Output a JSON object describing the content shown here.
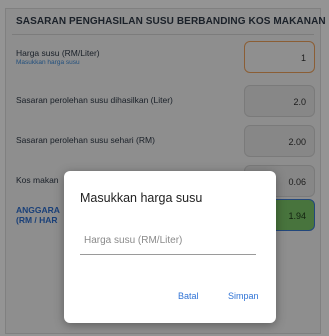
{
  "header": {
    "title": "SASARAN PENGHASILAN SUSU BERBANDING KOS MAKANAN"
  },
  "rows": [
    {
      "label": "Harga susu (RM/Liter)",
      "hint": "Masukkan harga susu",
      "value": "1"
    },
    {
      "label": "Sasaran perolehan susu dihasilkan (Liter)",
      "value": "2.0"
    },
    {
      "label": "Sasaran perolehan susu sehari (RM)",
      "value": "2.00"
    },
    {
      "label": "Kos makan",
      "value": "0.06"
    }
  ],
  "total": {
    "label_line1": "ANGGARA",
    "label_line2": "(RM / HAR",
    "value": "1.94"
  },
  "dialog": {
    "title": "Masukkan harga susu",
    "input_placeholder": "Harga susu (RM/Liter)",
    "cancel_label": "Batal",
    "save_label": "Simpan"
  },
  "colors": {
    "accent_blue": "#2f73d6",
    "input_highlight": "#f0a35c",
    "total_green": "#7cc96a"
  }
}
